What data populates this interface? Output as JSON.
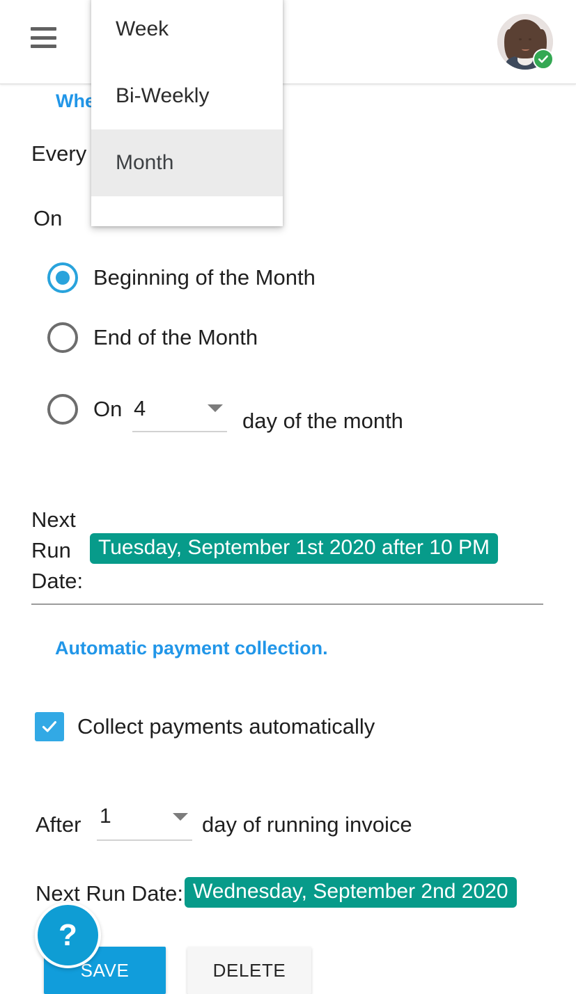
{
  "appbar": {
    "menu_icon": "hamburger-menu-icon",
    "avatar_icon": "user-avatar",
    "avatar_badge_icon": "verified-check-icon"
  },
  "dropdown": {
    "open": true,
    "options": [
      {
        "label": "Week",
        "selected": false
      },
      {
        "label": "Bi-Weekly",
        "selected": false
      },
      {
        "label": "Month",
        "selected": true
      }
    ]
  },
  "schedule": {
    "section_title": "When",
    "every_label": "Every",
    "on_label": "On",
    "frequency_value": "Month",
    "options": [
      {
        "label": "Beginning of the Month",
        "checked": true
      },
      {
        "label": "End of the Month",
        "checked": false
      }
    ],
    "on_day": {
      "prefix": "On",
      "value": "4",
      "suffix": "day of the month",
      "checked": false,
      "caret_icon": "chevron-down-icon"
    },
    "next_run": {
      "label": "Next Run Date:",
      "label_line1": "Next Run",
      "label_line2": "Date:",
      "value": "Tuesday, September 1st 2020 after 10 PM"
    }
  },
  "payment": {
    "section_title": "Automatic payment collection.",
    "checkbox": {
      "label": "Collect payments automatically",
      "checked": true,
      "icon": "checkmark-icon"
    },
    "after": {
      "prefix": "After",
      "value": "1",
      "suffix": "day of running invoice",
      "caret_icon": "chevron-down-icon"
    },
    "next_run": {
      "label": "Next Run Date:",
      "value": "Wednesday, September 2nd 2020"
    }
  },
  "actions": {
    "save_label": "SAVE",
    "delete_label": "DELETE",
    "help_label": "?"
  },
  "colors": {
    "accent_blue": "#2196e8",
    "radio_blue": "#29a3dc",
    "checkbox_blue": "#32a9e5",
    "badge_teal": "#079b8a",
    "save_blue": "#119ddb",
    "delete_grey": "#f6f6f6",
    "verified_green": "#34a853",
    "help_blue": "#0f9dd4",
    "highlight_grey": "#ebebeb"
  }
}
